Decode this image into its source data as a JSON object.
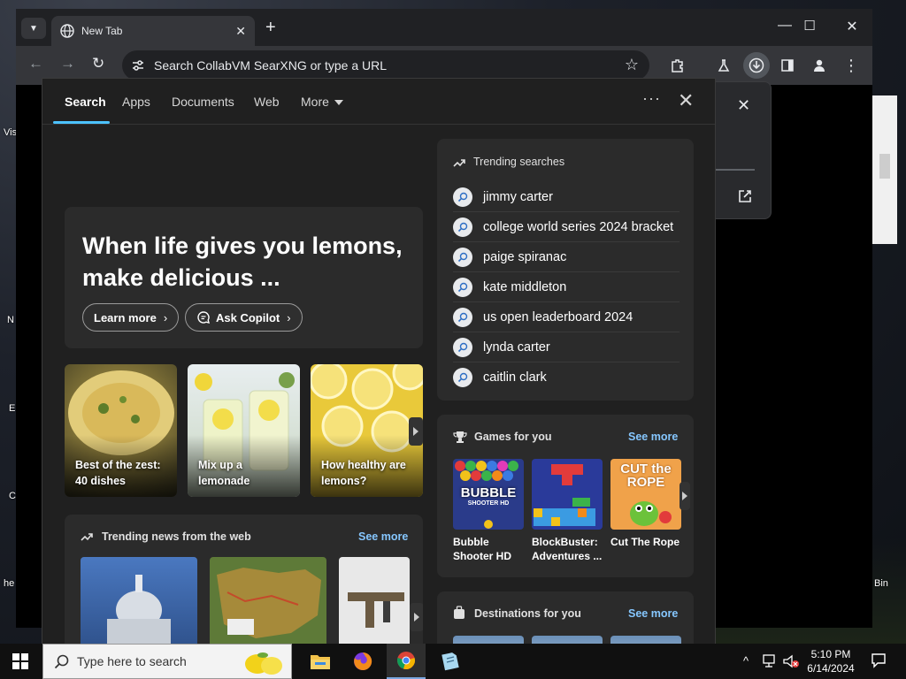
{
  "browser": {
    "tab_title": "New Tab",
    "omnibox_placeholder": "Search CollabVM SearXNG or type a URL"
  },
  "desktop": {
    "icon_labels": [
      "Vis",
      "N",
      "E",
      "C",
      "he",
      "Bin"
    ]
  },
  "panel": {
    "tabs": [
      "Search",
      "Apps",
      "Documents",
      "Web",
      "More"
    ],
    "active_tab": "Search",
    "hero": {
      "title": "When life gives you lemons, make delicious ...",
      "learn_more": "Learn more",
      "ask_copilot": "Ask Copilot"
    },
    "cards": [
      {
        "title": "Best of the zest: 40 dishes"
      },
      {
        "title": "Mix up a lemonade"
      },
      {
        "title": "How healthy are lemons?"
      }
    ],
    "news": {
      "heading": "Trending news from the web",
      "see_more": "See more"
    },
    "trending": {
      "heading": "Trending searches",
      "items": [
        "jimmy carter",
        "college world series 2024 bracket",
        "paige spiranac",
        "kate middleton",
        "us open leaderboard 2024",
        "lynda carter",
        "caitlin clark"
      ]
    },
    "games": {
      "heading": "Games for you",
      "see_more": "See more",
      "items": [
        {
          "title": "Bubble Shooter HD",
          "art": "BUBBLE"
        },
        {
          "title": "BlockBuster: Adventures ...",
          "art": ""
        },
        {
          "title": "Cut The Rope",
          "art": "CUT the ROPE"
        }
      ],
      "art_sub": "SHOOTER HD"
    },
    "destinations": {
      "heading": "Destinations for you",
      "see_more": "See more"
    }
  },
  "taskbar": {
    "search_placeholder": "Type here to search",
    "time": "5:10 PM",
    "date": "6/14/2024"
  },
  "colors": {
    "accent": "#4cc2ff",
    "link": "#86c7ff",
    "panel_bg": "#202020",
    "card_bg": "#2b2b2b"
  }
}
